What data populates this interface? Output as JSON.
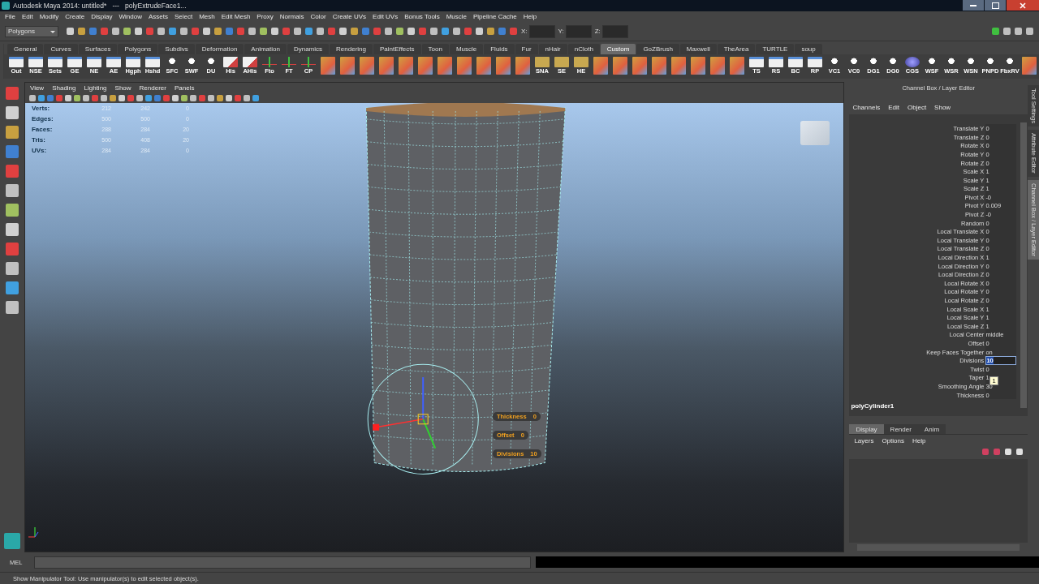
{
  "window": {
    "title": "Autodesk Maya 2014: untitled*   ---   polyExtrudeFace1..."
  },
  "menu_bar": [
    "File",
    "Edit",
    "Modify",
    "Create",
    "Display",
    "Window",
    "Assets",
    "Select",
    "Mesh",
    "Edit Mesh",
    "Proxy",
    "Normals",
    "Color",
    "Create UVs",
    "Edit UVs",
    "Bonus Tools",
    "Muscle",
    "Pipeline Cache",
    "Help"
  ],
  "status_line": {
    "mode": "Polygons",
    "coords": [
      "X:",
      "Y:",
      "Z:"
    ]
  },
  "shelf_tabs": [
    {
      "label": "General",
      "selected": false
    },
    {
      "label": "Curves",
      "selected": false
    },
    {
      "label": "Surfaces",
      "selected": false
    },
    {
      "label": "Polygons",
      "selected": false
    },
    {
      "label": "Subdivs",
      "selected": false
    },
    {
      "label": "Deformation",
      "selected": false
    },
    {
      "label": "Animation",
      "selected": false
    },
    {
      "label": "Dynamics",
      "selected": false
    },
    {
      "label": "Rendering",
      "selected": false
    },
    {
      "label": "PaintEffects",
      "selected": false
    },
    {
      "label": "Toon",
      "selected": false
    },
    {
      "label": "Muscle",
      "selected": false
    },
    {
      "label": "Fluids",
      "selected": false
    },
    {
      "label": "Fur",
      "selected": false
    },
    {
      "label": "nHair",
      "selected": false
    },
    {
      "label": "nCloth",
      "selected": false
    },
    {
      "label": "Custom",
      "selected": true
    },
    {
      "label": "GoZBrush",
      "selected": false
    },
    {
      "label": "Maxwell",
      "selected": false
    },
    {
      "label": "TheArea",
      "selected": false
    },
    {
      "label": "TURTLE",
      "selected": false
    },
    {
      "label": "soup",
      "selected": false
    }
  ],
  "shelf_buttons": [
    {
      "kind": "doc",
      "label": "Out"
    },
    {
      "kind": "doc",
      "label": "NSE"
    },
    {
      "kind": "doc",
      "label": "Sets"
    },
    {
      "kind": "doc",
      "label": "GE"
    },
    {
      "kind": "doc",
      "label": "NE"
    },
    {
      "kind": "doc",
      "label": "AE"
    },
    {
      "kind": "doc",
      "label": "Hgph"
    },
    {
      "kind": "doc",
      "label": "Hshd"
    },
    {
      "kind": "script",
      "label": "SFC"
    },
    {
      "kind": "script",
      "label": "SWF"
    },
    {
      "kind": "script",
      "label": "DU"
    },
    {
      "kind": "pen",
      "label": "His"
    },
    {
      "kind": "pen",
      "label": "AHis"
    },
    {
      "kind": "axes",
      "label": "Fto"
    },
    {
      "kind": "axes",
      "label": "FT"
    },
    {
      "kind": "axes",
      "label": "CP"
    },
    {
      "kind": "icon"
    },
    {
      "kind": "icon"
    },
    {
      "kind": "icon"
    },
    {
      "kind": "icon"
    },
    {
      "kind": "icon"
    },
    {
      "kind": "icon"
    },
    {
      "kind": "icon"
    },
    {
      "kind": "icon"
    },
    {
      "kind": "icon"
    },
    {
      "kind": "icon"
    },
    {
      "kind": "icon"
    },
    {
      "kind": "block",
      "label": "SNA"
    },
    {
      "kind": "block",
      "label": "SE"
    },
    {
      "kind": "block",
      "label": "HE"
    },
    {
      "kind": "icon"
    },
    {
      "kind": "icon"
    },
    {
      "kind": "icon"
    },
    {
      "kind": "icon"
    },
    {
      "kind": "icon"
    },
    {
      "kind": "icon"
    },
    {
      "kind": "icon"
    },
    {
      "kind": "icon"
    },
    {
      "kind": "doc",
      "label": "TS"
    },
    {
      "kind": "doc",
      "label": "RS"
    },
    {
      "kind": "doc",
      "label": "BC"
    },
    {
      "kind": "doc",
      "label": "RP"
    },
    {
      "kind": "script",
      "label": "VC1"
    },
    {
      "kind": "script",
      "label": "VC0"
    },
    {
      "kind": "script",
      "label": "DG1"
    },
    {
      "kind": "script",
      "label": "DG0"
    },
    {
      "kind": "sphere",
      "label": "CGS"
    },
    {
      "kind": "script",
      "label": "WSF"
    },
    {
      "kind": "script",
      "label": "WSR"
    },
    {
      "kind": "script",
      "label": "WSN"
    },
    {
      "kind": "script",
      "label": "PNPD"
    },
    {
      "kind": "script",
      "label": "FbxRV"
    },
    {
      "kind": "icon"
    }
  ],
  "viewport": {
    "menus": [
      "View",
      "Shading",
      "Lighting",
      "Show",
      "Renderer",
      "Panels"
    ],
    "stats": [
      {
        "label": "Verts:",
        "values": [
          "212",
          "242",
          "0"
        ]
      },
      {
        "label": "Edges:",
        "values": [
          "500",
          "500",
          "0"
        ]
      },
      {
        "label": "Faces:",
        "values": [
          "288",
          "284",
          "20"
        ]
      },
      {
        "label": "Tris:",
        "values": [
          "500",
          "408",
          "20"
        ]
      },
      {
        "label": "UVs:",
        "values": [
          "284",
          "284",
          "0"
        ]
      }
    ],
    "manipulator_labels": [
      {
        "label": "Thickness",
        "value": "0"
      },
      {
        "label": "Offset",
        "value": "0"
      },
      {
        "label": "Divisions",
        "value": "10"
      }
    ]
  },
  "channel_box": {
    "title": "Channel Box / Layer Editor",
    "menus": [
      "Channels",
      "Edit",
      "Object",
      "Show"
    ],
    "channels": [
      {
        "name": "Translate Y",
        "value": "0"
      },
      {
        "name": "Translate Z",
        "value": "0"
      },
      {
        "name": "Rotate X",
        "value": "0"
      },
      {
        "name": "Rotate Y",
        "value": "0"
      },
      {
        "name": "Rotate Z",
        "value": "0"
      },
      {
        "name": "Scale X",
        "value": "1"
      },
      {
        "name": "Scale Y",
        "value": "1"
      },
      {
        "name": "Scale Z",
        "value": "1"
      },
      {
        "name": "Pivot X",
        "value": "-0"
      },
      {
        "name": "Pivot Y",
        "value": "0.009"
      },
      {
        "name": "Pivot Z",
        "value": "-0"
      },
      {
        "name": "Random",
        "value": "0"
      },
      {
        "name": "Local Translate X",
        "value": "0"
      },
      {
        "name": "Local Translate Y",
        "value": "0"
      },
      {
        "name": "Local Translate Z",
        "value": "0"
      },
      {
        "name": "Local Direction X",
        "value": "1"
      },
      {
        "name": "Local Direction Y",
        "value": "0"
      },
      {
        "name": "Local Direction Z",
        "value": "0"
      },
      {
        "name": "Local Rotate X",
        "value": "0"
      },
      {
        "name": "Local Rotate Y",
        "value": "0"
      },
      {
        "name": "Local Rotate Z",
        "value": "0"
      },
      {
        "name": "Local Scale X",
        "value": "1"
      },
      {
        "name": "Local Scale Y",
        "value": "1"
      },
      {
        "name": "Local Scale Z",
        "value": "1"
      },
      {
        "name": "Local Center",
        "value": "middle"
      },
      {
        "name": "Offset",
        "value": "0"
      },
      {
        "name": "Keep Faces Together",
        "value": "on"
      },
      {
        "name": "Divisions",
        "value": "10",
        "editing": true
      },
      {
        "name": "Twist",
        "value": "0"
      },
      {
        "name": "Taper",
        "value": "1"
      },
      {
        "name": "Smoothing Angle",
        "value": "30"
      },
      {
        "name": "Thickness",
        "value": "0"
      }
    ],
    "tooltip": "1",
    "node": "polyCylinder1"
  },
  "side_tabs": [
    {
      "label": "Tool Settings",
      "selected": false
    },
    {
      "label": "Attribute Editor",
      "selected": false
    },
    {
      "label": "Channel Box / Layer Editor",
      "selected": true
    }
  ],
  "layer_editor": {
    "tabs": [
      {
        "label": "Display",
        "selected": true
      },
      {
        "label": "Render",
        "selected": false
      },
      {
        "label": "Anim",
        "selected": false
      }
    ],
    "menus": [
      "Layers",
      "Options",
      "Help"
    ]
  },
  "command_line": {
    "label": "MEL"
  },
  "help_line": "Show Manipulator Tool: Use manipulator(s) to edit selected object(s)."
}
